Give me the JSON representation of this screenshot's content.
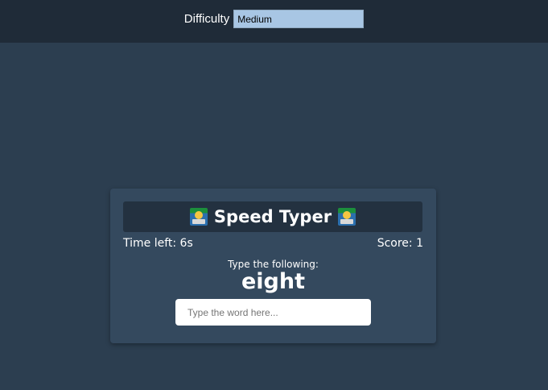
{
  "header": {
    "difficulty_label": "Difficulty",
    "difficulty_value": "Medium"
  },
  "game": {
    "title": "Speed Typer",
    "title_icon": "technologist-emoji",
    "time_left": "Time left: 6s",
    "score": "Score: 1",
    "prompt_label": "Type the following:",
    "word": "eight",
    "input_placeholder": "Type the word here...",
    "input_value": ""
  },
  "colors": {
    "page_background": "#2c3e50",
    "header_background": "#1f2b38",
    "card_background": "#34495e",
    "title_bar_background": "#233140",
    "select_background": "#a8c6e4"
  }
}
